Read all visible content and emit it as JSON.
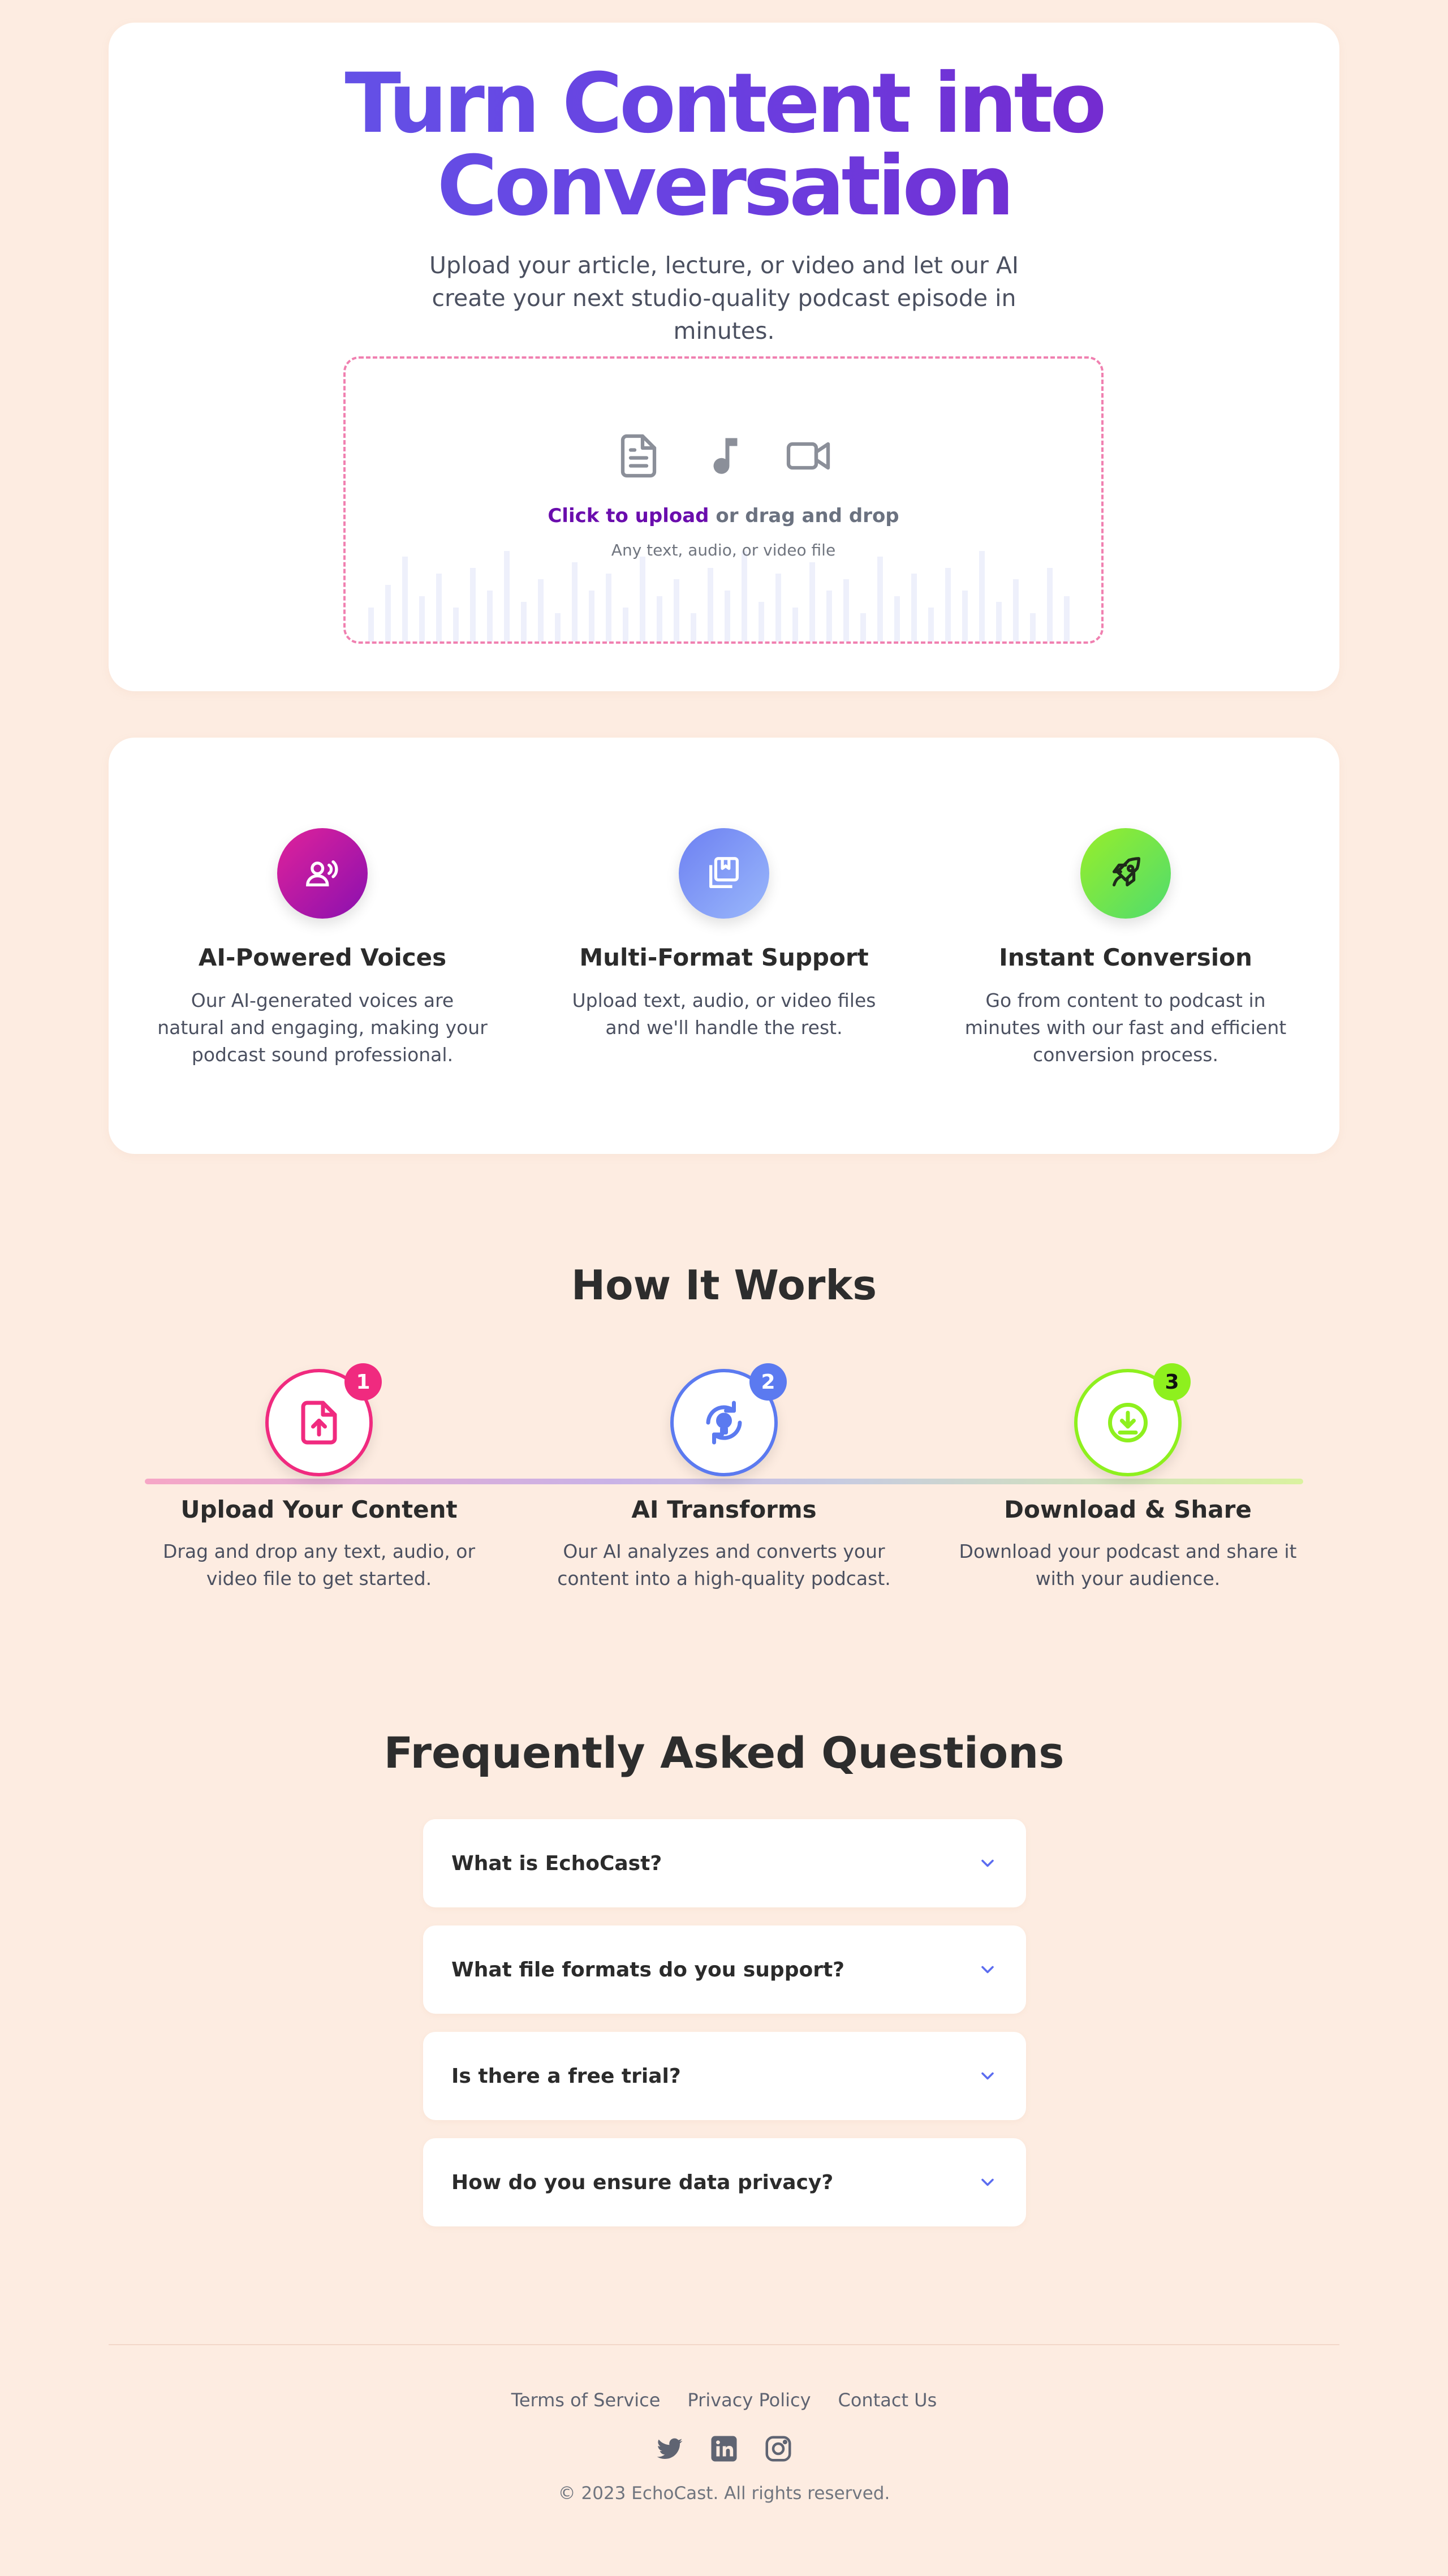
{
  "hero": {
    "title_line1": "Turn Content into",
    "title_line2": "Conversation",
    "subtitle": "Upload your article, lecture, or video and let our AI create your next studio-quality podcast episode in minutes.",
    "upload": {
      "link_text": "Click to upload",
      "rest_text": " or drag and drop",
      "hint": "Any text, audio, or video file",
      "icons": [
        "document-icon",
        "music-note-icon",
        "video-camera-icon"
      ]
    }
  },
  "features": [
    {
      "icon": "voice-icon",
      "title": "AI-Powered Voices",
      "text": "Our AI-generated voices are natural and engaging, making your podcast sound professional."
    },
    {
      "icon": "library-icon",
      "title": "Multi-Format Support",
      "text": "Upload text, audio, or video files and we'll handle the rest."
    },
    {
      "icon": "rocket-icon",
      "title": "Instant Conversion",
      "text": "Go from content to podcast in minutes with our fast and efficient conversion process."
    }
  ],
  "how": {
    "title": "How It Works",
    "steps": [
      {
        "number": "1",
        "icon": "file-upload-icon",
        "title": "Upload Your Content",
        "text": "Drag and drop any text, audio, or video file to get started.",
        "color": "#f02a7f"
      },
      {
        "number": "2",
        "icon": "ai-transform-icon",
        "title": "AI Transforms",
        "text": "Our AI analyzes and converts your content into a high-quality podcast.",
        "color": "#5b7af0"
      },
      {
        "number": "3",
        "icon": "download-icon",
        "title": "Download & Share",
        "text": "Download your podcast and share it with your audience.",
        "color": "#8ef01e"
      }
    ]
  },
  "faq": {
    "title": "Frequently Asked Questions",
    "items": [
      {
        "question": "What is EchoCast?"
      },
      {
        "question": "What file formats do you support?"
      },
      {
        "question": "Is there a free trial?"
      },
      {
        "question": "How do you ensure data privacy?"
      }
    ]
  },
  "footer": {
    "links": [
      "Terms of Service",
      "Privacy Policy",
      "Contact Us"
    ],
    "socials": [
      "twitter-icon",
      "linkedin-icon",
      "instagram-icon"
    ],
    "copyright": "© 2023 EchoCast. All rights reserved."
  },
  "colors": {
    "background": "#fdece1",
    "title_gradient_start": "#5f5bea",
    "title_gradient_end": "#7a1fc6",
    "upload_link": "#6a0dad",
    "dashed_border": "#f080b0",
    "faq_chevron": "#5b6cf0"
  }
}
